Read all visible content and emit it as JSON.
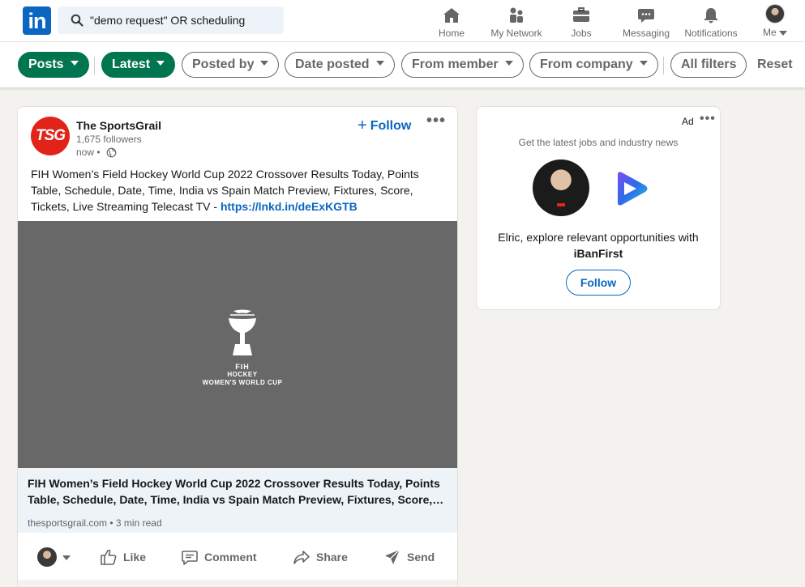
{
  "colors": {
    "brand": "#0a66c2",
    "active_filter": "#01754f",
    "tsg_red": "#e2231a"
  },
  "logo": {
    "text": "in"
  },
  "search": {
    "value": "\"demo request\" OR scheduling"
  },
  "nav": {
    "home": "Home",
    "network": "My Network",
    "jobs": "Jobs",
    "messaging": "Messaging",
    "notifications": "Notifications",
    "me": "Me"
  },
  "filters": {
    "posts": "Posts",
    "latest": "Latest",
    "posted_by": "Posted by",
    "date_posted": "Date posted",
    "from_member": "From member",
    "from_company": "From company",
    "all_filters": "All filters",
    "reset": "Reset"
  },
  "post": {
    "logo_text": "TSG",
    "author": "The SportsGrail",
    "followers": "1,675 followers",
    "time": "now",
    "follow_label": "Follow",
    "body": "FIH Women’s Field Hockey World Cup 2022 Crossover Results Today, Points Table, Schedule, Date, Time, India vs Spain Match Preview, Fixtures, Score, Tickets, Live Streaming Telecast TV - ",
    "link": "https://lnkd.in/deExKGTB",
    "image_text": {
      "line1": "FIH",
      "line2": "HOCKEY",
      "line3": "WOMEN'S WORLD CUP"
    },
    "preview": {
      "title": "FIH Women’s Field Hockey World Cup 2022 Crossover Results Today, Points Table, Schedule, Date, Time, India vs Spain Match Preview, Fixtures, Score,…",
      "domain": "thesportsgrail.com",
      "read_time": "3 min read"
    },
    "actions": {
      "like": "Like",
      "comment": "Comment",
      "share": "Share",
      "send": "Send"
    }
  },
  "ad": {
    "label": "Ad",
    "subtitle": "Get the latest jobs and industry news",
    "text": "Elric, explore relevant opportunities with",
    "company": "iBanFirst",
    "follow_label": "Follow"
  }
}
